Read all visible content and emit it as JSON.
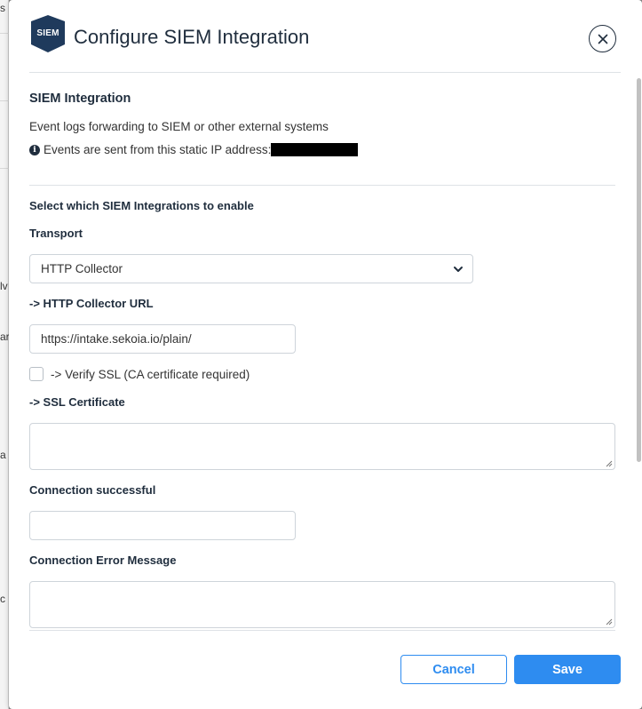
{
  "backdrop": {
    "fragments": [
      "s",
      "lv",
      "ar",
      "a",
      "c"
    ]
  },
  "dialog": {
    "logo_text": "SIEM",
    "title": "Configure SIEM Integration",
    "close_icon": "close-circle-icon"
  },
  "section": {
    "title": "SIEM Integration",
    "description": "Event logs forwarding to SIEM or other external systems",
    "ip_text": "Events are sent from this static IP address:",
    "info_icon": "info-circle-icon"
  },
  "form": {
    "enable_heading": "Select which SIEM Integrations to enable",
    "transport_label": "Transport",
    "transport_value": "HTTP Collector",
    "url_label": "-> HTTP Collector URL",
    "url_value": "https://intake.sekoia.io/plain/",
    "verify_ssl_label": "-> Verify SSL (CA certificate required)",
    "verify_ssl_checked": false,
    "ssl_cert_label": "-> SSL Certificate",
    "ssl_cert_value": "",
    "conn_success_label": "Connection successful",
    "conn_success_value": "",
    "conn_error_label": "Connection Error Message",
    "conn_error_value": ""
  },
  "footer": {
    "cancel_label": "Cancel",
    "save_label": "Save"
  },
  "colors": {
    "accent": "#2e8cf0",
    "logo_bg": "#1f3a5c",
    "text_dark": "#1f2d3d"
  }
}
